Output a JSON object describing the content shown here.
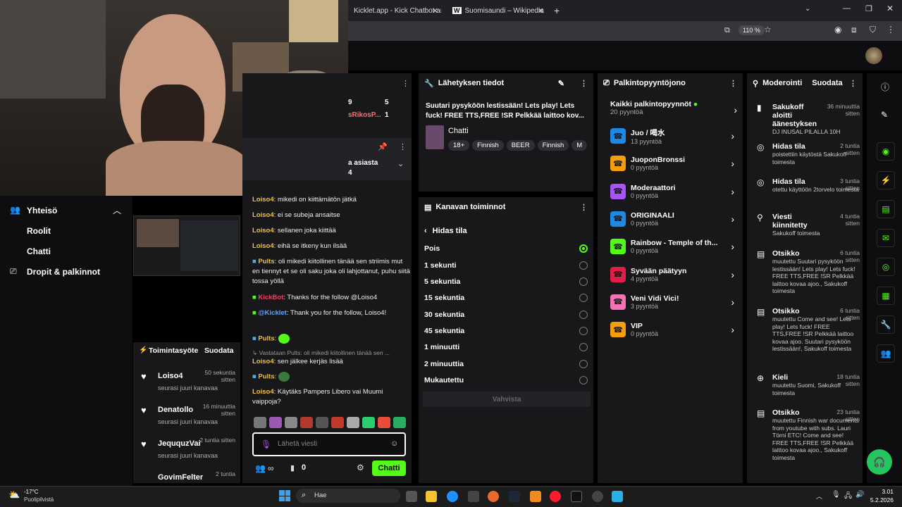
{
  "browser": {
    "tabs": [
      {
        "label": "Kicklet.app - Kick Chatbot and C"
      },
      {
        "label": "Suomisaundi – Wikipedia"
      }
    ],
    "zoom": "110 %"
  },
  "left_nav": {
    "community_label": "Yhteisö",
    "items": [
      {
        "label": "Roolit"
      },
      {
        "label": "Chatti"
      },
      {
        "label": "Dropit & palkinnot"
      }
    ]
  },
  "stats_fragment": [
    {
      "a": "9",
      "b": "5"
    },
    {
      "a": "sRikosP...",
      "b": "1"
    }
  ],
  "pinned_fragment": {
    "l1": "a asiasta",
    "l2": "4"
  },
  "activity_feed": {
    "title": "Toimintasyöte",
    "filter": "Suodata",
    "items": [
      {
        "name": "Loiso4",
        "desc": "seurasi juuri kanavaa",
        "time": "50 sekuntia sitten"
      },
      {
        "name": "Denatollo",
        "desc": "seurasi juuri kanavaa",
        "time": "16 minuuttia sitten"
      },
      {
        "name": "JeququzVai",
        "desc": "seurasi juuri kanavaa",
        "time": "2 tuntia sitten"
      },
      {
        "name": "GovimFelter",
        "desc": "",
        "time": "2 tuntia"
      }
    ]
  },
  "chat": {
    "messages": [
      {
        "user": "Loiso4",
        "text": "mikedi on kiittämätön jätkä"
      },
      {
        "user": "Loiso4",
        "text": "ei se subeja ansaitse"
      },
      {
        "user": "Loiso4",
        "text": "sellanen joka kiittää"
      },
      {
        "user": "Loiso4",
        "text": "eihä se itkeny kun ilsää"
      },
      {
        "user": "Pults",
        "text": "oli mikedi kiitollinen tänää sen striimis mut en tiennyt et se oli saku joka oli lahjottanut, puhu siitä tossa yöllä"
      },
      {
        "user": "KickBot",
        "text": "Thanks for the follow @Loiso4"
      },
      {
        "user": "@Kicklet",
        "text": "Thank you for the follow, Loiso4!"
      },
      {
        "user": "Pults",
        "text": ""
      },
      {
        "user": "",
        "text": "Vastataan Pults: oli mikedi kiitollinen tänää sen ..."
      },
      {
        "user": "Loiso4",
        "text": "sen jälkee kerjäs lisää"
      },
      {
        "user": "Pults",
        "text": ""
      },
      {
        "user": "Loiso4",
        "text": "Käytäks Pampers Libero vai Muumi vaippoja?"
      }
    ],
    "input_placeholder": "Lähetä viesti",
    "counter": "0",
    "send_label": "Chatti"
  },
  "stream_info": {
    "title": "Lähetyksen tiedot",
    "stream_title": "Suutari pysyköön lestissään! Lets play! Lets fuck! FREE TTS,FREE !SR Pelkkää laittoo kov...",
    "category": "Chatti",
    "tags": [
      "18+",
      "Finnish",
      "BEER",
      "Finnish",
      "M"
    ]
  },
  "channel_actions": {
    "title": "Kanavan toiminnot",
    "back_label": "Hidas tila",
    "options": [
      {
        "label": "Pois",
        "selected": true
      },
      {
        "label": "1 sekunti",
        "selected": false
      },
      {
        "label": "5 sekuntia",
        "selected": false
      },
      {
        "label": "15 sekuntia",
        "selected": false
      },
      {
        "label": "30 sekuntia",
        "selected": false
      },
      {
        "label": "45 sekuntia",
        "selected": false
      },
      {
        "label": "1 minuutti",
        "selected": false
      },
      {
        "label": "2 minuuttia",
        "selected": false
      },
      {
        "label": "Mukautettu",
        "selected": false
      }
    ],
    "confirm_label": "Vahvista"
  },
  "rewards": {
    "title": "Palkintopyyntöjono",
    "all_label": "Kaikki palkintopyynnöt",
    "all_count": "20 pyyntöä",
    "items": [
      {
        "name": "Juo / 喝水",
        "count": "13 pyyntöä",
        "color": "#1e88e5"
      },
      {
        "name": "JuoponBronssi",
        "count": "0 pyyntöä",
        "color": "#f59e0b"
      },
      {
        "name": "Moderaattori",
        "count": "0 pyyntöä",
        "color": "#a855f7"
      },
      {
        "name": "ORIGINAALI",
        "count": "0 pyyntöä",
        "color": "#1e88e5"
      },
      {
        "name": "Rainbow - Temple of th...",
        "count": "0 pyyntöä",
        "color": "#53fc18"
      },
      {
        "name": "Syvään päätyyn",
        "count": "4 pyyntöä",
        "color": "#e11d48"
      },
      {
        "name": "Veni Vidi Vici!",
        "count": "3 pyyntöä",
        "color": "#f472b6"
      },
      {
        "name": "VIP",
        "count": "0 pyyntöä",
        "color": "#f59e0b"
      }
    ]
  },
  "moderation": {
    "title": "Moderointi",
    "filter": "Suodata",
    "items": [
      {
        "title": "Sakukoff aloitti äänestyksen",
        "body": "DJ INUSAL PILALLA 10H",
        "time": "36 minuuttia sitten",
        "icon": "▮"
      },
      {
        "title": "Hidas tila",
        "body": "poistettiin käytöstä Sakukoff toimesta",
        "time": "2 tuntia sitten",
        "icon": "◎"
      },
      {
        "title": "Hidas tila",
        "body": "otettu käyttöön 2torvelo toimesta",
        "time": "3 tuntia sitten",
        "icon": "◎"
      },
      {
        "title": "Viesti kiinnitetty",
        "body": "Sakukoff toimesta",
        "time": "4 tuntia sitten",
        "icon": "⚲"
      },
      {
        "title": "Otsikko",
        "body": "muutettu Suutari pysyköön lestissään! Lets play! Lets fuck! FREE TTS,FREE !SR Pelkkää laittoo kovaa ajoo., Sakukoff toimesta",
        "time": "6 tuntia sitten",
        "icon": "▤"
      },
      {
        "title": "Otsikko",
        "body": "muutettu Come and see! Lets play! Lets fuck! FREE TTS,FREE !SR Pelkkää laittoo kovaa ajoo. Suutari pysyköön lestissään!, Sakukoff toimesta",
        "time": "6 tuntia sitten",
        "icon": "▤"
      },
      {
        "title": "Kieli",
        "body": "muutettu Suomi, Sakukoff toimesta",
        "time": "18 tuntia sitten",
        "icon": "⊕"
      },
      {
        "title": "Otsikko",
        "body": "muutettu Finnish war documents from youtube with subs. Lauri Törni ETC! Come and see! FREE TTS,FREE !SR Pelkkää laittoo kovaa ajoo., Sakukoff toimesta",
        "time": "23 tuntia sitten",
        "icon": "▤"
      }
    ]
  },
  "taskbar": {
    "weather_temp": "-17°C",
    "weather_desc": "Puolipilvistä",
    "search": "Hae",
    "time": "3.01",
    "date": "5.2.2026"
  }
}
